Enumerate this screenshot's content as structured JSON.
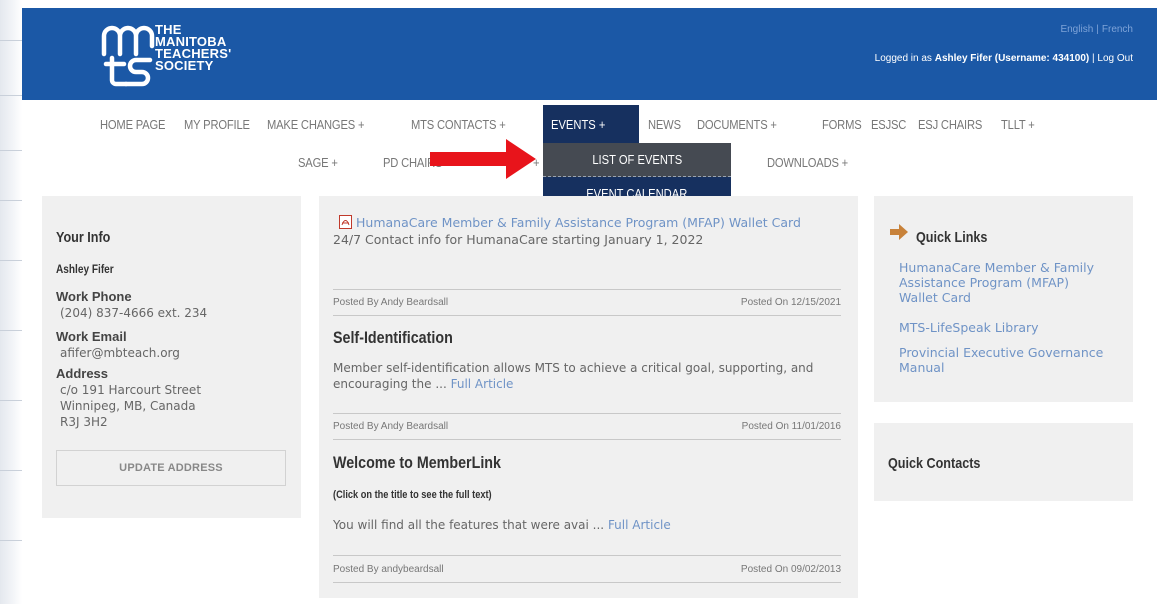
{
  "header": {
    "logo_lines": [
      "THE",
      "MANITOBA",
      "TEACHERS'",
      "SOCIETY"
    ],
    "lang": {
      "english": "English",
      "french": "French"
    },
    "user": {
      "prefix": "Logged in as ",
      "name": "Ashley Fifer (Username: 434100)",
      "sep": " | ",
      "logout": "Log Out"
    }
  },
  "nav": {
    "row1": [
      "HOME PAGE",
      "MY PROFILE",
      "MAKE CHANGES +",
      "MTS CONTACTS +",
      "EVENTS +",
      "NEWS",
      "DOCUMENTS +",
      "FORMS",
      "ESJSC",
      "ESJ CHAIRS",
      "TLLT +"
    ],
    "row2": [
      "SAGE +",
      "PD CHAIRS +",
      "+",
      "DOWNLOADS +"
    ],
    "dropdown": [
      "LIST OF EVENTS",
      "EVENT CALENDAR"
    ]
  },
  "your_info": {
    "title": "Your Info",
    "name": "Ashley Fifer",
    "work_phone_label": "Work Phone",
    "work_phone": "(204) 837-4666 ext. 234",
    "work_email_label": "Work Email",
    "work_email": "afifer@mbteach.org",
    "address_label": "Address",
    "address_lines": [
      "c/o 191 Harcourt Street",
      "Winnipeg, MB, Canada",
      "R3J 3H2"
    ],
    "update_button": "UPDATE ADDRESS"
  },
  "articles": {
    "top_link": "HumanaCare Member & Family Assistance Program (MFAP) Wallet Card",
    "top_desc": "24/7 Contact info for HumanaCare starting January 1, 2022",
    "meta1": {
      "by": "Posted By Andy Beardsall",
      "on": "Posted On 12/15/2021"
    },
    "a1": {
      "title": "Self-Identification",
      "body": "Member self-identification allows MTS to achieve a critical goal, supporting, and encouraging the ...",
      "link": "Full Article"
    },
    "meta2": {
      "by": "Posted By Andy Beardsall",
      "on": "Posted On 11/01/2016"
    },
    "a2": {
      "title": "Welcome to MemberLink",
      "subtitle": "(Click on the title to see the full text)",
      "body": "You will find all the features that were avai ...",
      "link": "Full Article"
    },
    "meta3": {
      "by": "Posted By andybeardsall",
      "on": "Posted On 09/02/2013"
    }
  },
  "quick_links": {
    "title": "Quick Links",
    "items": [
      "HumanaCare Member & Family Assistance Program (MFAP) Wallet Card",
      "MTS-LifeSpeak Library",
      "Provincial Executive Governance Manual"
    ]
  },
  "quick_contacts": {
    "title": "Quick Contacts"
  },
  "colors": {
    "header_blue": "#1b58a6",
    "nav_active": "#16305f",
    "link_blue": "#6f93c6",
    "arrow_red": "#e8141b",
    "ql_arrow": "#c8823a"
  }
}
